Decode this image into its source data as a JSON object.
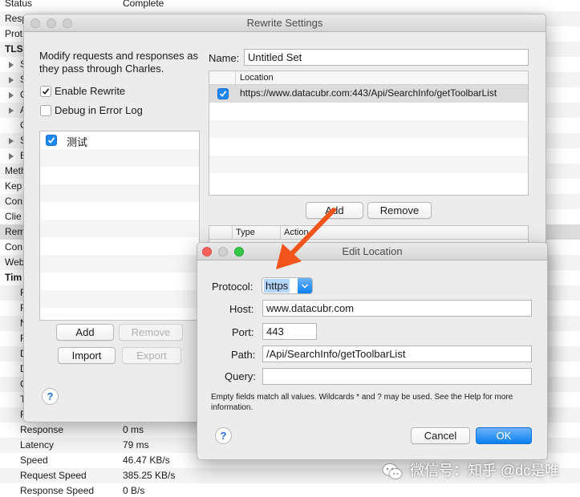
{
  "background": {
    "rows": [
      {
        "key": "Status",
        "value": "Complete"
      },
      {
        "key": "Resp",
        "value": ""
      },
      {
        "key": "Prot",
        "value": ""
      },
      {
        "key": "TLS",
        "value": ""
      },
      {
        "key": "S",
        "value": ""
      },
      {
        "key": "S",
        "value": ""
      },
      {
        "key": "C",
        "value": ""
      },
      {
        "key": "A",
        "value": ""
      },
      {
        "key": "C",
        "value": ""
      },
      {
        "key": "S",
        "value": ""
      },
      {
        "key": "E",
        "value": ""
      },
      {
        "key": "Meth",
        "value": ""
      },
      {
        "key": "Kep",
        "value": ""
      },
      {
        "key": "Con",
        "value": ""
      },
      {
        "key": "Clie",
        "value": ""
      },
      {
        "key": "Rem",
        "value": ""
      },
      {
        "key": "Con",
        "value": ""
      },
      {
        "key": "Web",
        "value": ""
      },
      {
        "key": "Tim",
        "value": ""
      },
      {
        "key": "R",
        "value": ""
      },
      {
        "key": "R",
        "value": ""
      },
      {
        "key": "N",
        "value": ""
      },
      {
        "key": "R",
        "value": ""
      },
      {
        "key": "D",
        "value": ""
      },
      {
        "key": "D",
        "value": ""
      },
      {
        "key": "C",
        "value": ""
      },
      {
        "key": "T",
        "value": ""
      },
      {
        "key": "R",
        "value": ""
      },
      {
        "key": "Response",
        "value": "0 ms"
      },
      {
        "key": "Latency",
        "value": "79 ms"
      },
      {
        "key": "Speed",
        "value": "46.47 KB/s"
      },
      {
        "key": "Request Speed",
        "value": "385.25 KB/s"
      },
      {
        "key": "Response Speed",
        "value": "0 B/s"
      }
    ]
  },
  "rewrite": {
    "title": "Rewrite Settings",
    "description": "Modify requests and responses as they pass through Charles.",
    "enable_label": "Enable Rewrite",
    "debug_label": "Debug in Error Log",
    "sets": [
      {
        "name": "测试",
        "checked": true
      }
    ],
    "add": "Add",
    "remove": "Remove",
    "import": "Import",
    "export": "Export",
    "help": "?",
    "name_label": "Name:",
    "name_value": "Untitled Set",
    "location_header": "Location",
    "locations": [
      {
        "url": "https://www.datacubr.com:443/Api/SearchInfo/getToolbarList",
        "checked": true
      }
    ],
    "loc_add": "Add",
    "loc_remove": "Remove",
    "rules_header_type": "Type",
    "rules_header_action": "Action"
  },
  "edit_location": {
    "title": "Edit Location",
    "protocol_label": "Protocol:",
    "protocol_value": "https",
    "host_label": "Host:",
    "host_value": "www.datacubr.com",
    "port_label": "Port:",
    "port_value": "443",
    "path_label": "Path:",
    "path_value": "/Api/SearchInfo/getToolbarList",
    "query_label": "Query:",
    "query_value": "",
    "hint": "Empty fields match all values. Wildcards * and ? may be used. See the Help for more information.",
    "cancel": "Cancel",
    "ok": "OK",
    "help": "?"
  },
  "watermark": {
    "text": "微信号：知乎 @dc是唯"
  },
  "colors": {
    "arrow": "#f2541b",
    "accent": "#1e88f5",
    "selection": "#b4d5fe"
  }
}
